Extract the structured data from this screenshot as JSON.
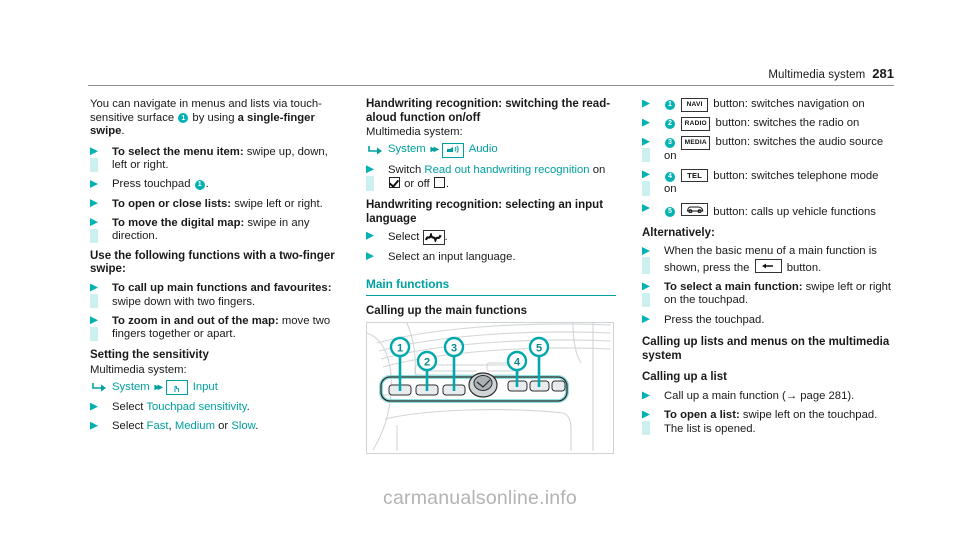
{
  "header": {
    "title": "Multimedia system",
    "page_number": "281"
  },
  "watermark": "carmanualsonline.info",
  "column_left": {
    "intro": {
      "text_a": "You can navigate in menus and lists via touch-sensitive surface",
      "callout": "1",
      "text_b": "by using",
      "bold_b": "a single-finger swipe",
      "text_c": "."
    },
    "bullets": [
      {
        "bold": "To select the menu item:",
        "rest": "swipe up, down, left or right."
      },
      {
        "bold": "",
        "rest": "Press touchpad",
        "callout": "1",
        "tail": "."
      },
      {
        "bold": "To open or close lists:",
        "rest": "swipe left or right."
      },
      {
        "bold": "To move the digital map:",
        "rest": "swipe in any direction."
      }
    ],
    "two_finger_heading": "Use the following functions with a two-finger swipe:",
    "two_finger_bullets": [
      {
        "bold": "To call up main functions and favourites:",
        "rest": "swipe down with two fingers."
      },
      {
        "bold": "To zoom in and out of the map:",
        "rest": "move two fingers together or apart."
      }
    ],
    "sensitivity_heading": "Setting the sensitivity",
    "sensitivity_sub": "Multimedia system:",
    "breadcrumb": {
      "arrow_icon": "corner-arrow-icon",
      "first": "System",
      "chevron": "▸▸",
      "icon": "hand-input-icon",
      "second": "Input"
    },
    "select_bullets": [
      {
        "prefix": "Select",
        "link": "Touchpad sensitivity",
        "tail": "."
      },
      {
        "prefix": "Select",
        "links": [
          "Fast",
          "Medium",
          "Slow"
        ],
        "sep": ", ",
        "or": " or ",
        "tail": "."
      }
    ]
  },
  "column_middle": {
    "heading_1": "Handwriting recognition: switching the read-aloud function on/off",
    "sub_1": "Multimedia system:",
    "breadcrumb": {
      "arrow_icon": "corner-arrow-icon",
      "first": "System",
      "chevron": "▸▸",
      "icon": "audio-speaker-icon",
      "second": "Audio"
    },
    "switch_bullet": {
      "prefix": "Switch",
      "link": "Read out handwriting recognition",
      "mid": "on",
      "checkbox_on": "checkbox-checked-icon",
      "or": "or off",
      "checkbox_off": "checkbox-unchecked-icon",
      "tail": "."
    },
    "heading_2": "Handwriting recognition: selecting an input language",
    "bullets": [
      {
        "prefix": "Select",
        "icon": "handwriting-scribble-icon",
        "tail": "."
      },
      {
        "prefix": "Select an input language.",
        "icon": "",
        "tail": ""
      }
    ],
    "section_heading": "Main functions",
    "section_sub": "Calling up the main functions",
    "figure": {
      "name": "centre-console-illustration",
      "callouts": [
        "1",
        "2",
        "3",
        "4",
        "5"
      ]
    }
  },
  "column_right": {
    "button_list": [
      {
        "num": "1",
        "key": "NAVI",
        "text": "button: switches navigation on"
      },
      {
        "num": "2",
        "key": "RADIO",
        "text": "button: switches the radio on"
      },
      {
        "num": "3",
        "key": "MEDIA",
        "text": "button: switches the audio source on"
      },
      {
        "num": "4",
        "key": "TEL",
        "text": "button: switches telephone mode on"
      },
      {
        "num": "5",
        "key": "",
        "key_icon": "car-vehicle-icon",
        "text": "button: calls up vehicle functions"
      }
    ],
    "alternatively_heading": "Alternatively:",
    "alt_bullets": [
      {
        "pre": "When the basic menu of a main function is shown, press the",
        "icon": "back-button-icon",
        "post": "button."
      },
      {
        "bold": "To select a main function:",
        "rest": "swipe left or right on the touchpad."
      },
      {
        "bold": "",
        "rest": "Press the touchpad."
      }
    ],
    "lists_heading": "Calling up lists and menus on the multimedia system",
    "lists_sub": "Calling up a list",
    "lists_bullets": [
      {
        "bold": "",
        "rest": "Call up a main function (→ page 281)."
      },
      {
        "bold": "To open a list:",
        "rest": "swipe left on the touchpad.",
        "extra": "The list is opened."
      }
    ]
  },
  "colors": {
    "teal": "#00a0a0",
    "teal_bright": "#00b2b2",
    "teal_pale": "#ccf0f0",
    "rule_grey": "#8f8f8f",
    "watermark_grey": "#b3b3b3"
  }
}
